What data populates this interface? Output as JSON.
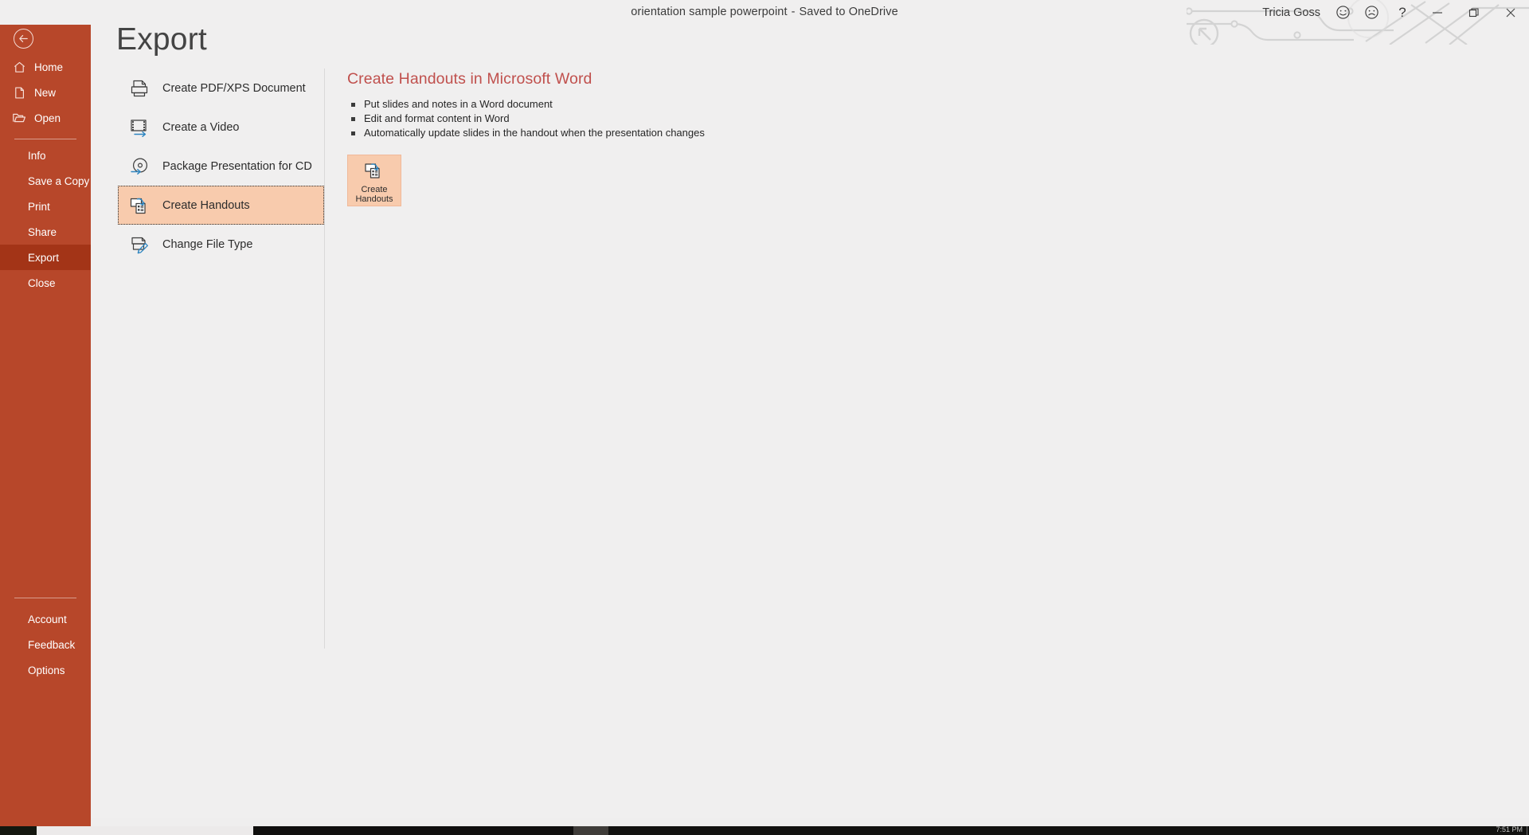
{
  "titlebar": {
    "document_name": "orientation sample powerpoint",
    "separator": "-",
    "save_status": "Saved to OneDrive",
    "user_name": "Tricia Goss",
    "happy_icon": "smiley-happy-icon",
    "sad_icon": "smiley-sad-icon",
    "help_label": "?",
    "minimize_label": "minimize-icon",
    "restore_label": "restore-icon",
    "close_label": "close-icon"
  },
  "backstage": {
    "back_button": "back-arrow-icon",
    "page_title": "Export",
    "nav_top": [
      {
        "label": "Home",
        "icon": "home-icon"
      },
      {
        "label": "New",
        "icon": "new-document-icon"
      },
      {
        "label": "Open",
        "icon": "open-folder-icon"
      }
    ],
    "nav_mid": [
      {
        "label": "Info",
        "active": false
      },
      {
        "label": "Save a Copy",
        "active": false
      },
      {
        "label": "Print",
        "active": false
      },
      {
        "label": "Share",
        "active": false
      },
      {
        "label": "Export",
        "active": true
      },
      {
        "label": "Close",
        "active": false
      }
    ],
    "nav_bottom": [
      {
        "label": "Account"
      },
      {
        "label": "Feedback"
      },
      {
        "label": "Options"
      }
    ]
  },
  "export_options": [
    {
      "label": "Create PDF/XPS Document",
      "icon": "pdf-document-icon",
      "selected": false
    },
    {
      "label": "Create a Video",
      "icon": "video-film-icon",
      "selected": false
    },
    {
      "label": "Package Presentation for CD",
      "icon": "cd-disc-icon",
      "selected": false
    },
    {
      "label": "Create Handouts",
      "icon": "handouts-icon",
      "selected": true
    },
    {
      "label": "Change File Type",
      "icon": "file-type-pencil-icon",
      "selected": false
    }
  ],
  "detail": {
    "title": "Create Handouts in Microsoft Word",
    "bullets": [
      "Put slides and notes in a Word document",
      "Edit and format content in Word",
      "Automatically update slides in the handout when the presentation changes"
    ],
    "action_button": {
      "icon": "handouts-icon",
      "line1": "Create",
      "line2": "Handouts"
    }
  },
  "taskbar": {
    "clock": "7:51 PM"
  },
  "colors": {
    "rail": "#b7472a",
    "rail_active": "#a33417",
    "selection": "#f8cbad",
    "heading": "#c0504d",
    "canvas": "#f0efef"
  }
}
